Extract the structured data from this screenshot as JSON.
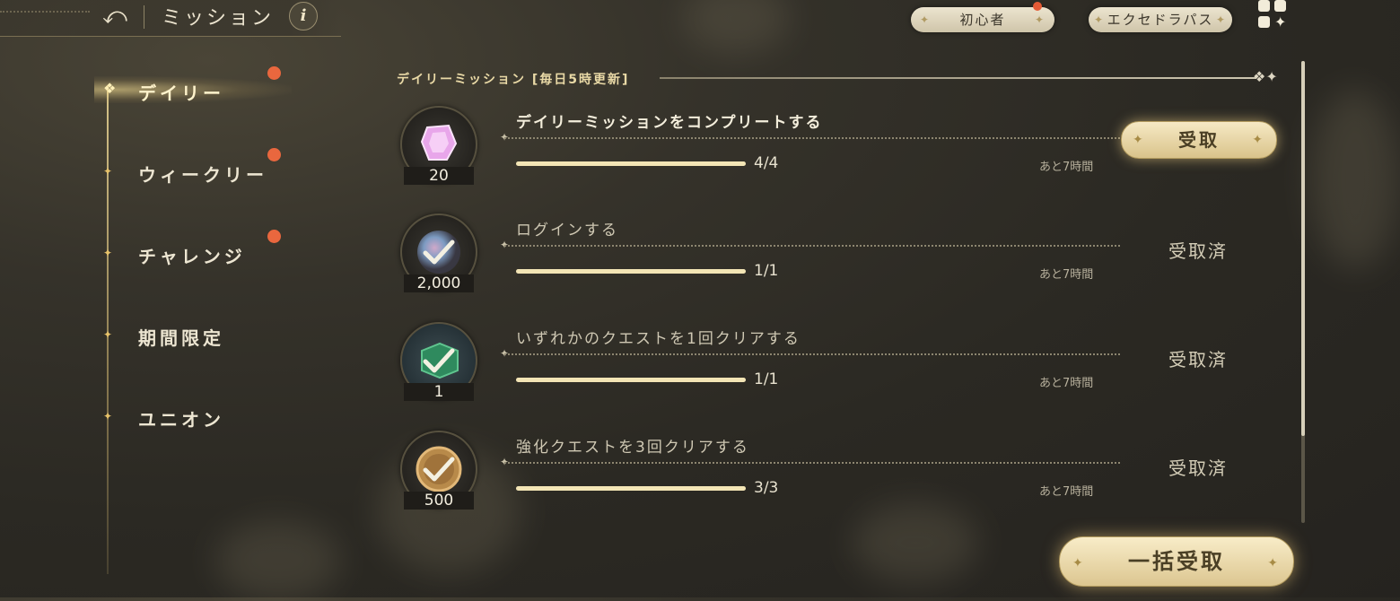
{
  "header": {
    "back_icon": "back-arrow-icon",
    "title": "ミッション",
    "info_label": "i"
  },
  "top_buttons": {
    "beginner": "初心者",
    "pass": "エクセドラパス",
    "menu_icon": "grid-menu-icon"
  },
  "sidebar": {
    "items": [
      {
        "label": "デイリー",
        "active": true,
        "badge": true
      },
      {
        "label": "ウィークリー",
        "active": false,
        "badge": true
      },
      {
        "label": "チャレンジ",
        "active": false,
        "badge": true
      },
      {
        "label": "期間限定",
        "active": false,
        "badge": false
      },
      {
        "label": "ユニオン",
        "active": false,
        "badge": false
      }
    ]
  },
  "section": {
    "title": "デイリーミッション [毎日5時更新]"
  },
  "missions": [
    {
      "title": "デイリーミッションをコンプリートする",
      "reward_icon": "pink-gem-icon",
      "reward_count": "20",
      "progress": "4/4",
      "progress_fraction": 1.0,
      "time_left": "あと7時間",
      "status": "claimable",
      "claim_label": "受取"
    },
    {
      "title": "ログインする",
      "reward_icon": "rainbow-orb-icon",
      "reward_count": "2,000",
      "progress": "1/1",
      "progress_fraction": 1.0,
      "time_left": "あと7時間",
      "status": "claimed",
      "claimed_label": "受取済"
    },
    {
      "title": "いずれかのクエストを1回クリアする",
      "reward_icon": "green-cube-icon",
      "reward_count": "1",
      "progress": "1/1",
      "progress_fraction": 1.0,
      "time_left": "あと7時間",
      "status": "claimed",
      "claimed_label": "受取済"
    },
    {
      "title": "強化クエストを3回クリアする",
      "reward_icon": "gold-coin-icon",
      "reward_count": "500",
      "progress": "3/3",
      "progress_fraction": 1.0,
      "time_left": "あと7時間",
      "status": "claimed",
      "claimed_label": "受取済"
    }
  ],
  "footer": {
    "bulk_claim": "一括受取"
  },
  "colors": {
    "accent_gold": "#e8c36a",
    "badge_red": "#e9673e",
    "bar_fill": "#f3e5b5"
  }
}
